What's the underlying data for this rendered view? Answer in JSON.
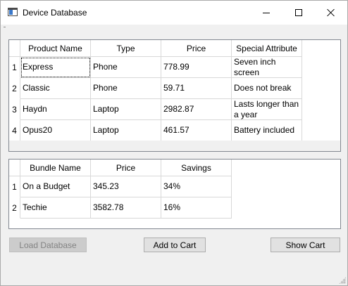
{
  "window": {
    "title": "Device Database",
    "icon": "app-window-icon"
  },
  "products": {
    "columns": [
      "Product Name",
      "Type",
      "Price",
      "Special Attribute"
    ],
    "rows": [
      {
        "num": "1",
        "cells": [
          "Express",
          "Phone",
          "778.99",
          "Seven inch screen"
        ]
      },
      {
        "num": "2",
        "cells": [
          "Classic",
          "Phone",
          "59.71",
          "Does not break"
        ]
      },
      {
        "num": "3",
        "cells": [
          "Haydn",
          "Laptop",
          "2982.87",
          "Lasts longer than a year"
        ]
      },
      {
        "num": "4",
        "cells": [
          "Opus20",
          "Laptop",
          "461.57",
          "Battery included"
        ]
      }
    ]
  },
  "bundles": {
    "columns": [
      "Bundle Name",
      "Price",
      "Savings"
    ],
    "rows": [
      {
        "num": "1",
        "cells": [
          "On a Budget",
          "345.23",
          "34%"
        ]
      },
      {
        "num": "2",
        "cells": [
          "Techie",
          "3582.78",
          "16%"
        ]
      }
    ]
  },
  "buttons": {
    "load": "Load Database",
    "add": "Add to Cart",
    "show": "Show Cart"
  }
}
